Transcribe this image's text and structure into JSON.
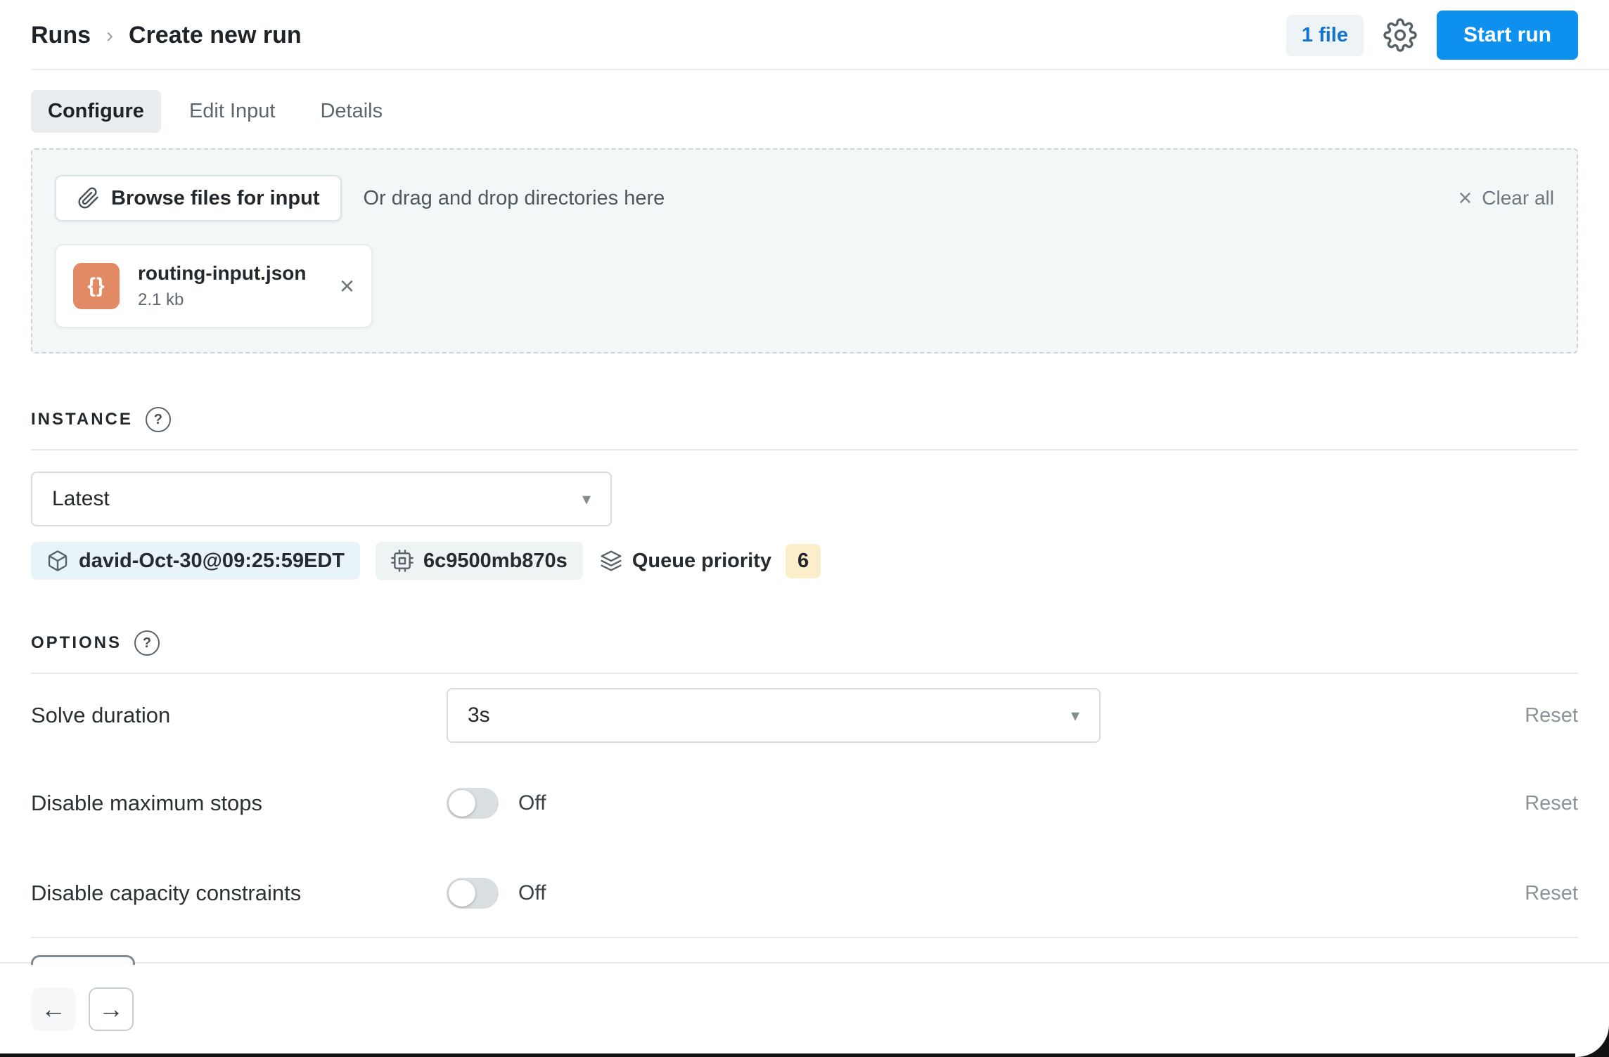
{
  "header": {
    "breadcrumb": {
      "parent": "Runs",
      "separator": "›",
      "current": "Create new run"
    },
    "file_count": "1 file",
    "start_run": "Start run"
  },
  "tabs": {
    "configure": "Configure",
    "edit_input": "Edit Input",
    "details": "Details"
  },
  "upload": {
    "browse_label": "Browse files for input",
    "drag_hint": "Or drag and drop directories here",
    "clear_all": "Clear all",
    "file": {
      "name": "routing-input.json",
      "size": "2.1 kb",
      "icon_glyph": "{}"
    }
  },
  "instance": {
    "title": "INSTANCE",
    "help": "?",
    "version_selected": "Latest",
    "tags": {
      "instance_tag": "david-Oct-30@09:25:59EDT",
      "device_tag": "6c9500mb870s",
      "queue_label": "Queue priority",
      "queue_value": "6"
    }
  },
  "options": {
    "title": "OPTIONS",
    "help": "?",
    "rows": [
      {
        "label": "Solve duration",
        "value": "3s",
        "reset": "Reset"
      },
      {
        "label": "Disable maximum stops",
        "value": "Off",
        "reset": "Reset"
      },
      {
        "label": "Disable capacity constraints",
        "value": "Off",
        "reset": "Reset"
      }
    ]
  },
  "footer": {
    "back": "←",
    "forward": "→"
  },
  "glyphs": {
    "caret": "▾",
    "close": "×"
  },
  "colors": {
    "accent_blue": "#0d90ee",
    "link_blue": "#1472cc",
    "file_icon_orange": "#e28a64",
    "badge_yellow": "#fbeecb",
    "tag_blue_bg": "#e9f4f9",
    "dropzone_bg": "#f3f7f8"
  }
}
